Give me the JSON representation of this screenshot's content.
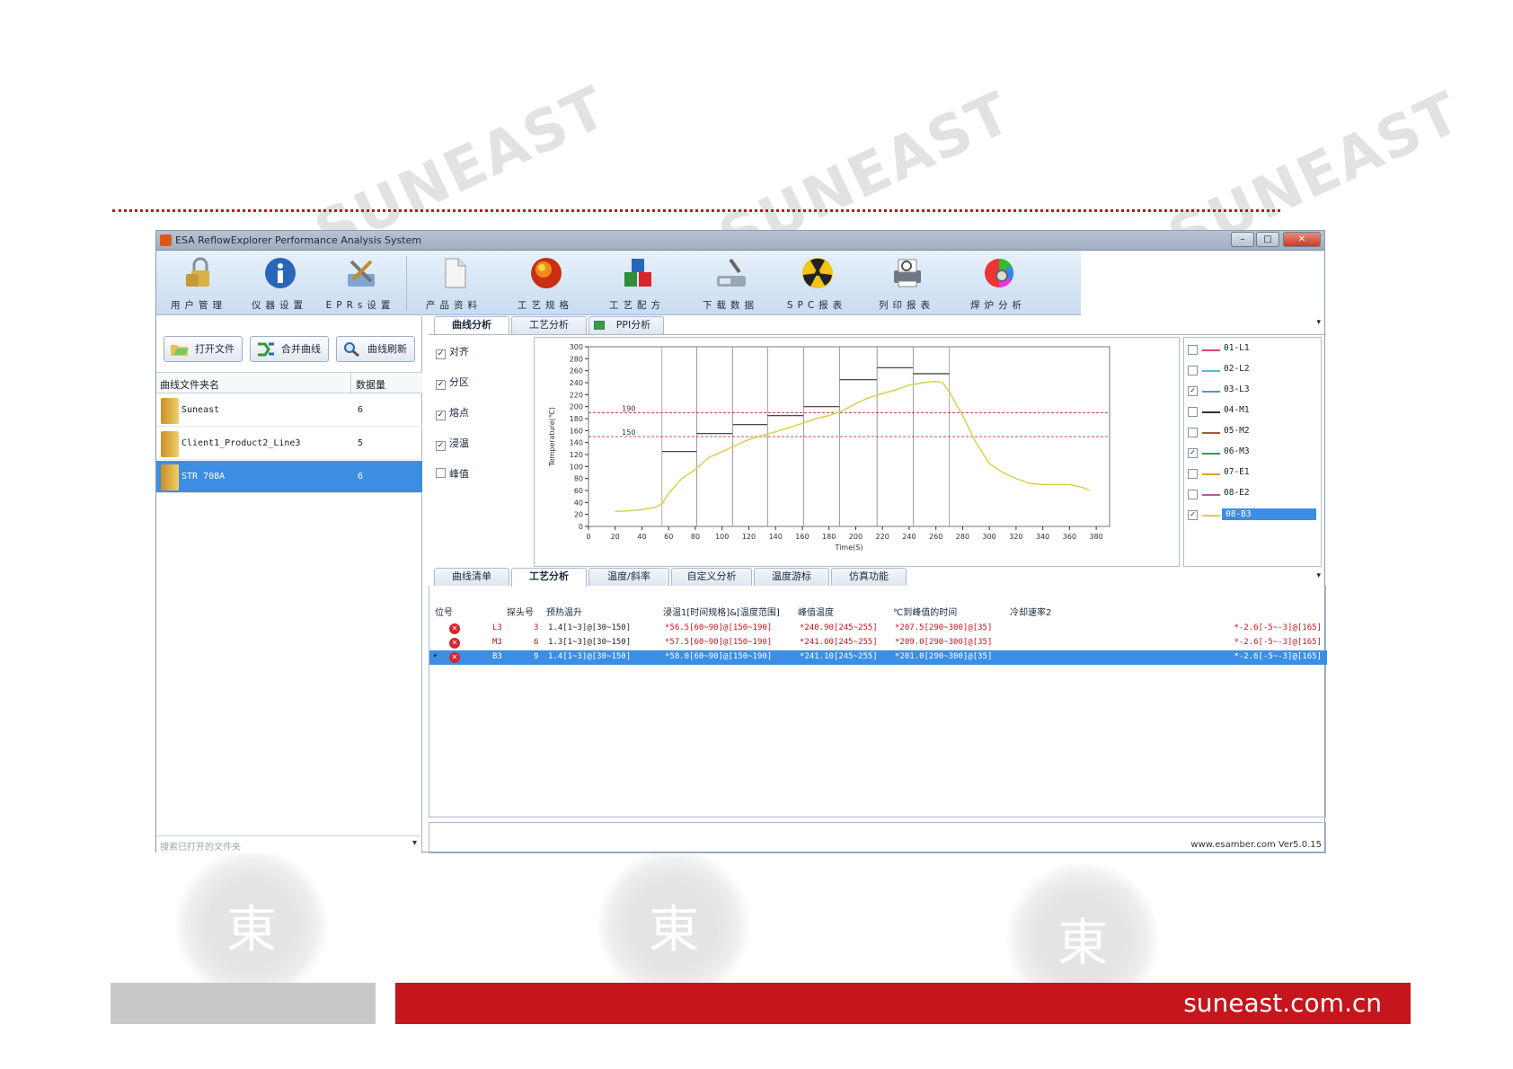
{
  "watermark_text": "SUNEAST",
  "footer": {
    "site": "suneast.com.cn"
  },
  "window": {
    "title": "ESA ReflowExplorer Performance Analysis System",
    "controls": {
      "minimize": "–",
      "maximize": "□",
      "close": "✕"
    }
  },
  "toolbar": {
    "items": [
      {
        "label": "用户管理",
        "icon": "users-lock-icon"
      },
      {
        "label": "仪器设置",
        "icon": "info-icon"
      },
      {
        "label": "EPRs设置",
        "icon": "tools-icon"
      },
      {
        "label": "产品资料",
        "icon": "document-icon"
      },
      {
        "label": "工艺规格",
        "icon": "fireball-icon"
      },
      {
        "label": "工艺配方",
        "icon": "cubes-icon"
      },
      {
        "label": "下载数据",
        "icon": "download-device-icon"
      },
      {
        "label": "SPC报表",
        "icon": "radiation-icon"
      },
      {
        "label": "列印报表",
        "icon": "printer-icon"
      },
      {
        "label": "焊炉分析",
        "icon": "color-wheel-icon"
      }
    ]
  },
  "left": {
    "buttons": {
      "open": "打开文件",
      "merge": "合并曲线",
      "refresh": "曲线刷新"
    },
    "columns": {
      "name": "曲线文件夹名",
      "count": "数据量"
    },
    "files": [
      {
        "name": "Suneast",
        "count": "6"
      },
      {
        "name": "Client1_Product2_Line3",
        "count": "5"
      },
      {
        "name": "STR 708A",
        "count": "6"
      }
    ],
    "search_placeholder": "搜索已打开的文件夹"
  },
  "top_tabs": [
    "曲线分析",
    "工艺分析",
    "PPI分析"
  ],
  "options": [
    {
      "label": "对齐",
      "checked": true
    },
    {
      "label": "分区",
      "checked": true
    },
    {
      "label": "熔点",
      "checked": true
    },
    {
      "label": "浸温",
      "checked": true
    },
    {
      "label": "峰值",
      "checked": false
    }
  ],
  "chart_data": {
    "type": "line",
    "xlabel": "Time(S)",
    "ylabel": "Temperature(℃)",
    "xlim": [
      0,
      390
    ],
    "ylim": [
      0,
      300
    ],
    "x_ticks": [
      0,
      20,
      40,
      60,
      80,
      100,
      120,
      140,
      160,
      180,
      200,
      220,
      240,
      260,
      280,
      300,
      320,
      340,
      360,
      380
    ],
    "y_ticks": [
      0,
      20,
      40,
      60,
      80,
      100,
      120,
      140,
      160,
      180,
      200,
      220,
      240,
      260,
      280,
      300
    ],
    "reference_lines": [
      {
        "value": 190,
        "label": "190"
      },
      {
        "value": 150,
        "label": "150"
      }
    ],
    "zones": [
      {
        "x_start": 55,
        "x_end": 81,
        "temp": 125
      },
      {
        "x_start": 81,
        "x_end": 108,
        "temp": 155
      },
      {
        "x_start": 108,
        "x_end": 134,
        "temp": 170
      },
      {
        "x_start": 134,
        "x_end": 161,
        "temp": 185
      },
      {
        "x_start": 161,
        "x_end": 188,
        "temp": 200
      },
      {
        "x_start": 188,
        "x_end": 216,
        "temp": 245
      },
      {
        "x_start": 216,
        "x_end": 243,
        "temp": 265
      },
      {
        "x_start": 243,
        "x_end": 270,
        "temp": 255
      }
    ],
    "series": [
      {
        "name": "08-B3",
        "color": "#d8d04a",
        "x": [
          20,
          30,
          40,
          50,
          55,
          60,
          70,
          80,
          90,
          100,
          110,
          120,
          130,
          140,
          150,
          160,
          170,
          180,
          190,
          200,
          210,
          220,
          230,
          240,
          250,
          260,
          265,
          270,
          280,
          290,
          300,
          310,
          320,
          330,
          340,
          350,
          360,
          370,
          375
        ],
        "y": [
          25,
          26,
          28,
          32,
          38,
          55,
          80,
          95,
          115,
          125,
          135,
          145,
          152,
          158,
          165,
          172,
          180,
          185,
          193,
          205,
          215,
          222,
          228,
          236,
          240,
          242,
          240,
          225,
          185,
          140,
          105,
          90,
          80,
          72,
          70,
          70,
          70,
          65,
          60
        ]
      }
    ]
  },
  "legend": [
    {
      "label": "01-L1",
      "color": "#e0427d",
      "checked": false
    },
    {
      "label": "02-L2",
      "color": "#59b6e0",
      "checked": false
    },
    {
      "label": "03-L3",
      "color": "#5c93c8",
      "checked": true
    },
    {
      "label": "04-M1",
      "color": "#333333",
      "checked": false
    },
    {
      "label": "05-M2",
      "color": "#a55a3c",
      "checked": false
    },
    {
      "label": "06-M3",
      "color": "#3a9a4a",
      "checked": true
    },
    {
      "label": "07-E1",
      "color": "#e0a02a",
      "checked": false
    },
    {
      "label": "08-E2",
      "color": "#b85ab0",
      "checked": false
    },
    {
      "label": "08-B3",
      "color": "#d8d04a",
      "checked": true
    }
  ],
  "bottom_tabs": [
    "曲线清单",
    "工艺分析",
    "温度/斜率",
    "自定义分析",
    "温度游标",
    "仿真功能"
  ],
  "grid": {
    "headers": [
      "位号",
      "探头号",
      "预热温升",
      "浸温1[时间规格]&[温度范围]",
      "峰值温度",
      "℃到峰值的时间",
      "冷却速率2"
    ],
    "rows": [
      {
        "pos": "L3",
        "probe": "3",
        "preheat": "1.4[1~3]@[30~150]",
        "soak": "*56.5[60~90]@[150~190]",
        "peak": "*240.90[245~255]",
        "time": "*207.5[290~300]@[35]",
        "cool": "*-2.6[-5~-3]@[165]"
      },
      {
        "pos": "M3",
        "probe": "6",
        "preheat": "1.3[1~3]@[30~150]",
        "soak": "*57.5[60~90]@[150~190]",
        "peak": "*241.00[245~255]",
        "time": "*209.0[290~300]@[35]",
        "cool": "*-2.6[-5~-3]@[165]"
      },
      {
        "pos": "B3",
        "probe": "9",
        "preheat": "1.4[1~3]@[30~150]",
        "soak": "*58.0[60~90]@[150~190]",
        "peak": "*241.10[245~255]",
        "time": "*201.0[290~300]@[35]",
        "cool": "*-2.6[-5~-3]@[165]"
      }
    ]
  },
  "status": {
    "version": "www.esamber.com Ver5.0.15"
  }
}
